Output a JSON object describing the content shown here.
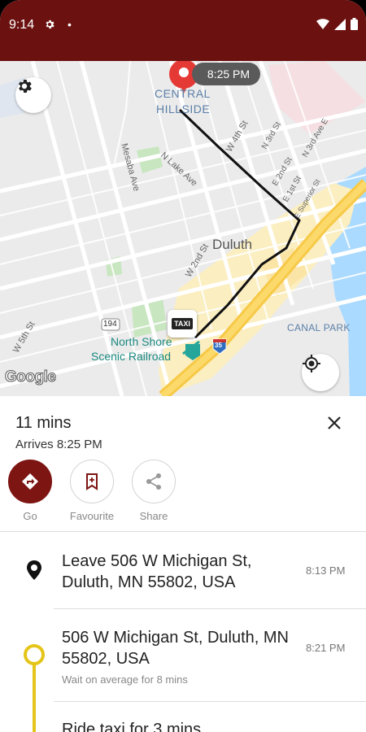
{
  "status_bar": {
    "time": "9:14"
  },
  "map": {
    "pickup_time_chip": "8:25 PM",
    "labels": {
      "central_hillside_1": "CENTRAL",
      "central_hillside_2": "HILLSIDE",
      "duluth": "Duluth",
      "canal_park": "CANAL PARK",
      "north_shore_1": "North Shore",
      "north_shore_2": "Scenic Railroad",
      "n_lake_ave": "N Lake Ave",
      "mesaba_ave": "Mesaba Ave",
      "w_2nd_st": "W 2nd St",
      "w_4th_st": "W 4th St",
      "w_5th_st": "W 5th St",
      "n_4th_st": "N 4th St",
      "n_3rd_st": "N 3rd St",
      "e_1st_st": "E 1st St",
      "superior_st": "E Superior St",
      "n_3rd_ave_e": "N 3rd Ave E",
      "e_2nd_st": "E 2nd St",
      "hwy_194": "194",
      "hwy_35": "35",
      "taxi": "TAXI"
    },
    "google_logo": "Google"
  },
  "trip": {
    "duration": "11 mins",
    "arrival": "Arrives 8:25 PM"
  },
  "actions": [
    {
      "label": "Go",
      "icon": "directions-icon"
    },
    {
      "label": "Favourite",
      "icon": "bookmark-icon"
    },
    {
      "label": "Share",
      "icon": "share-icon"
    }
  ],
  "steps": [
    {
      "title": "Leave 506 W Michigan St, Duluth, MN 55802, USA",
      "time": "8:13 PM",
      "note": ""
    },
    {
      "title": "506 W Michigan St, Duluth, MN 55802, USA",
      "time": "8:21 PM",
      "note": "Wait on average for 8 mins"
    },
    {
      "title": "Ride taxi for 3 mins",
      "time": "",
      "note": ""
    }
  ],
  "colors": {
    "status_bar": "#6b1210",
    "primary": "#7d1512",
    "route": "#111111",
    "transit_line": "#e5c51a"
  }
}
